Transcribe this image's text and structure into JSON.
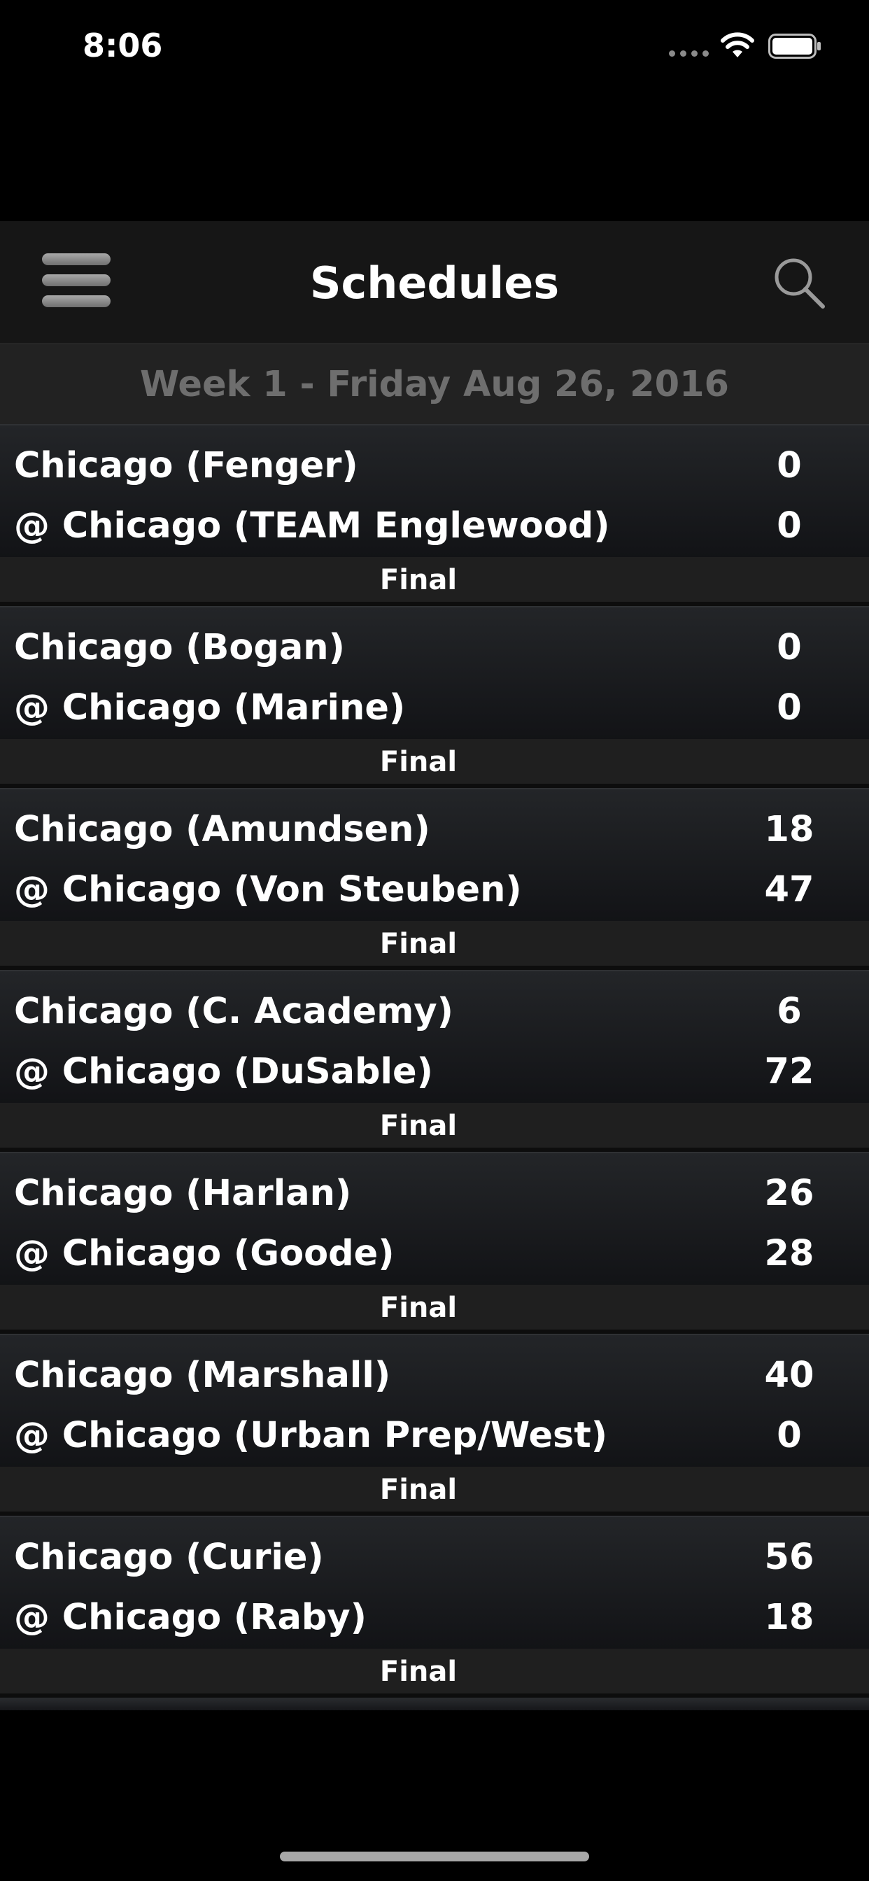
{
  "status_bar": {
    "time": "8:06",
    "icons": [
      "signal-dots-icon",
      "wifi-icon",
      "battery-icon"
    ]
  },
  "nav": {
    "title": "Schedules",
    "menu_icon": "hamburger-menu-icon",
    "search_icon": "search-icon"
  },
  "week_header": {
    "label": "Week 1 - Friday Aug 26, 2016"
  },
  "games": [
    {
      "away_team": "Chicago (Fenger)",
      "away_score": "0",
      "home_team": "@ Chicago (TEAM Englewood)",
      "home_score": "0",
      "status": "Final"
    },
    {
      "away_team": "Chicago (Bogan)",
      "away_score": "0",
      "home_team": "@ Chicago (Marine)",
      "home_score": "0",
      "status": "Final"
    },
    {
      "away_team": "Chicago (Amundsen)",
      "away_score": "18",
      "home_team": "@ Chicago (Von Steuben)",
      "home_score": "47",
      "status": "Final"
    },
    {
      "away_team": "Chicago (C. Academy)",
      "away_score": "6",
      "home_team": "@ Chicago (DuSable)",
      "home_score": "72",
      "status": "Final"
    },
    {
      "away_team": "Chicago (Harlan)",
      "away_score": "26",
      "home_team": "@ Chicago (Goode)",
      "home_score": "28",
      "status": "Final"
    },
    {
      "away_team": "Chicago (Marshall)",
      "away_score": "40",
      "home_team": "@ Chicago (Urban Prep/West)",
      "home_score": "0",
      "status": "Final"
    },
    {
      "away_team": "Chicago (Curie)",
      "away_score": "56",
      "home_team": "@ Chicago (Raby)",
      "home_score": "18",
      "status": "Final"
    }
  ],
  "colors": {
    "background": "#000000",
    "nav_background": "#161616",
    "week_header_text": "#6e6e6e",
    "text": "#ffffff"
  }
}
